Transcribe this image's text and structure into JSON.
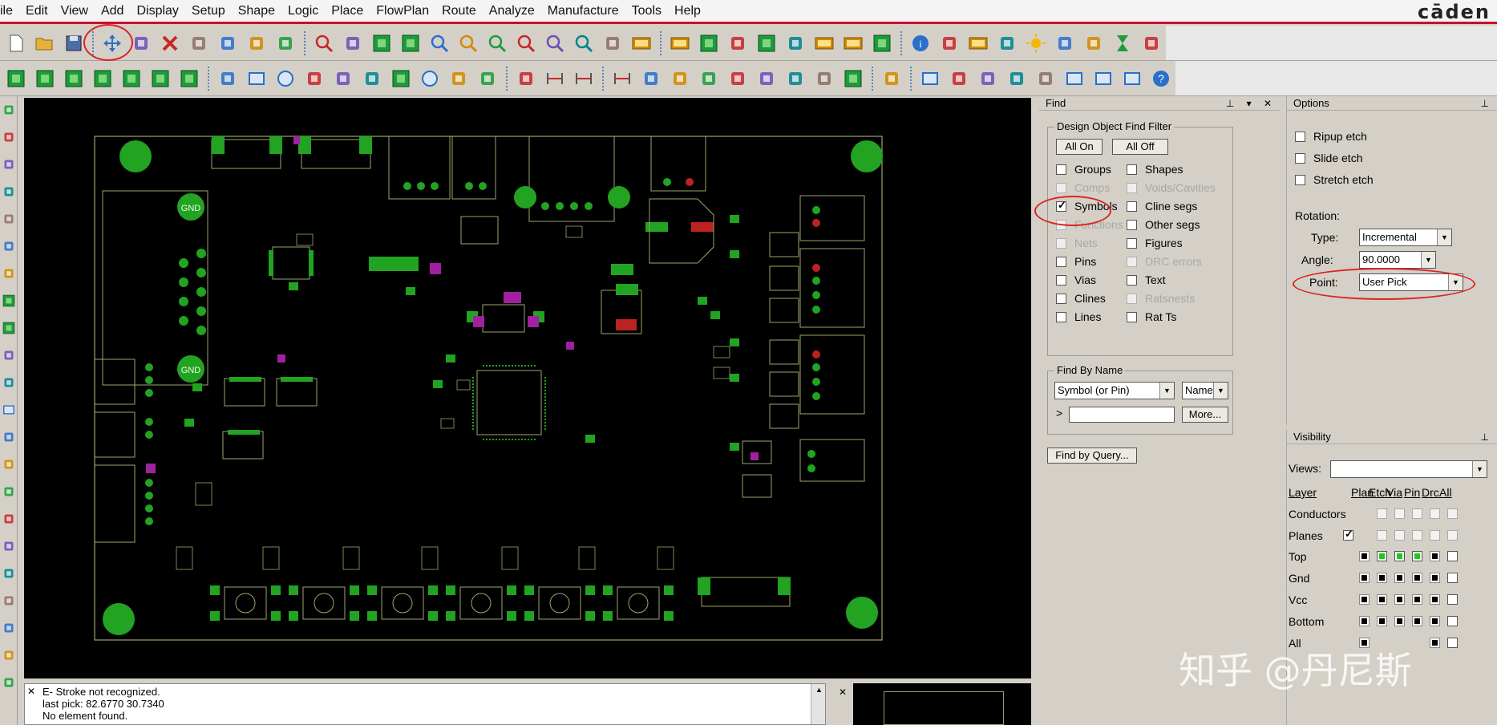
{
  "menu": {
    "items": [
      "ile",
      "Edit",
      "View",
      "Add",
      "Display",
      "Setup",
      "Shape",
      "Logic",
      "Place",
      "FlowPlan",
      "Route",
      "Analyze",
      "Manufacture",
      "Tools",
      "Help"
    ],
    "brand": "cāden"
  },
  "toolbar1": {
    "icons": [
      "new-icon",
      "open-icon",
      "save-icon",
      "move-icon",
      "copy-icon",
      "delete-icon",
      "undo-icon",
      "undo-list-icon",
      "redo-icon",
      "redo-list-icon",
      "zoom-window-icon",
      "pin-icon",
      "grid-view-icon",
      "grid-icon",
      "zoom-fit-icon",
      "zoom-in-icon",
      "zoom-in-icon",
      "zoom-out-icon",
      "zoom-previous-icon",
      "zoom-world-icon",
      "redraw-icon",
      "3d-view-icon",
      "flip-icon",
      "grid-toggle-icon",
      "color-icon",
      "layers-icon",
      "shadow-icon",
      "dmy-icon",
      "ofa-icon",
      "stats-icon",
      "info-icon",
      "show-element-icon",
      "123-icon",
      "highlight-icon",
      "sun-icon",
      "dehighlight-icon",
      "bars-icon",
      "hourglass-icon",
      "drc-icon"
    ]
  },
  "toolbar2": {
    "icons": [
      "component-a-icon",
      "component-b-icon",
      "component-c-icon",
      "component-d-icon",
      "component-e-icon",
      "component-f-icon",
      "component-g-icon",
      "shape-line-icon",
      "shape-rect-icon",
      "shape-circle-icon",
      "select-shape-icon",
      "merge-shapes-icon",
      "void-icon",
      "shape-box-icon",
      "shape-circle2-icon",
      "shape-edit-icon",
      "stamp-icon",
      "place-icon",
      "dimension-icon",
      "dimension2-icon",
      "dim-ext-icon",
      "slide-icon",
      "compact-icon",
      "snapshot-icon",
      "resistor-icon",
      "flag-icon",
      "fanout-icon",
      "test-point-icon",
      "pad-array-icon",
      "route-icon",
      "note-icon",
      "gift-icon",
      "package-icon",
      "check-icon",
      "tweak-icon",
      "window-icon",
      "mail-icon",
      "box-icon",
      "help-icon"
    ]
  },
  "find": {
    "panel_title": "Find",
    "filter_title": "Design Object Find Filter",
    "all_on": "All On",
    "all_off": "All Off",
    "left_items": [
      {
        "label": "Groups",
        "checked": false,
        "disabled": false
      },
      {
        "label": "Comps",
        "checked": false,
        "disabled": true
      },
      {
        "label": "Symbols",
        "checked": true,
        "disabled": false
      },
      {
        "label": "Functions",
        "checked": false,
        "disabled": true
      },
      {
        "label": "Nets",
        "checked": false,
        "disabled": true
      },
      {
        "label": "Pins",
        "checked": false,
        "disabled": false
      },
      {
        "label": "Vias",
        "checked": false,
        "disabled": false
      },
      {
        "label": "Clines",
        "checked": false,
        "disabled": false
      },
      {
        "label": "Lines",
        "checked": false,
        "disabled": false
      }
    ],
    "right_items": [
      {
        "label": "Shapes",
        "checked": false,
        "disabled": false
      },
      {
        "label": "Voids/Cavities",
        "checked": false,
        "disabled": true
      },
      {
        "label": "Cline segs",
        "checked": false,
        "disabled": false
      },
      {
        "label": "Other segs",
        "checked": false,
        "disabled": false
      },
      {
        "label": "Figures",
        "checked": false,
        "disabled": false
      },
      {
        "label": "DRC errors",
        "checked": false,
        "disabled": true
      },
      {
        "label": "Text",
        "checked": false,
        "disabled": false
      },
      {
        "label": "Ratsnests",
        "checked": false,
        "disabled": true
      },
      {
        "label": "Rat Ts",
        "checked": false,
        "disabled": false
      }
    ],
    "by_name_title": "Find By Name",
    "by_name_type": "Symbol (or Pin)",
    "by_name_mode": "Name",
    "by_name_prompt": ">",
    "by_name_value": "",
    "more": "More...",
    "by_query": "Find by Query..."
  },
  "options": {
    "panel_title": "Options",
    "ripup_etch": "Ripup etch",
    "slide_etch": "Slide etch",
    "stretch_etch": "Stretch etch",
    "rotation_label": "Rotation:",
    "type_label": "Type:",
    "type_value": "Incremental",
    "angle_label": "Angle:",
    "angle_value": "90.0000",
    "point_label": "Point:",
    "point_value": "User Pick"
  },
  "visibility": {
    "panel_title": "Visibility",
    "views_label": "Views:",
    "views_value": "",
    "layer_header": "Layer",
    "columns": [
      "Plan",
      "Etch",
      "Via",
      "Pin",
      "Drc",
      "All"
    ],
    "conductors": "Conductors",
    "planes": "Planes",
    "layers": [
      {
        "name": "Top",
        "colors": [
          "black",
          "green",
          "green",
          "green",
          "black",
          "empty"
        ]
      },
      {
        "name": "Gnd",
        "colors": [
          "black",
          "black",
          "black",
          "black",
          "black",
          "empty"
        ]
      },
      {
        "name": "Vcc",
        "colors": [
          "black",
          "black",
          "black",
          "black",
          "black",
          "empty"
        ]
      },
      {
        "name": "Bottom",
        "colors": [
          "black",
          "black",
          "black",
          "black",
          "black",
          "empty"
        ]
      },
      {
        "name": "All",
        "colors": [
          "black",
          "",
          "",
          "",
          "black",
          "empty"
        ]
      }
    ]
  },
  "command": {
    "lines": [
      "E- Stroke not recognized.",
      "last pick:  82.6770 30.7340",
      "No element found."
    ]
  },
  "canvas": {
    "gnd_top": "GND",
    "gnd_bottom": "GND"
  },
  "watermark": "知乎 @丹尼斯"
}
